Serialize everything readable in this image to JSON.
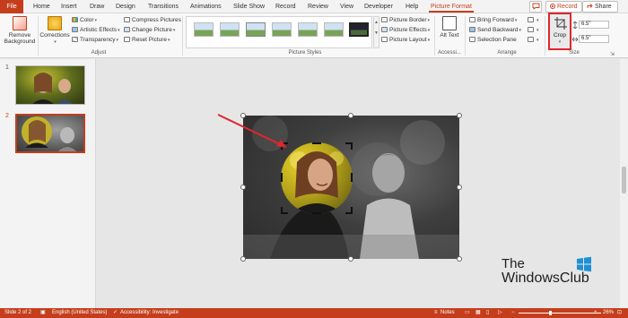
{
  "tabs": [
    "File",
    "Home",
    "Insert",
    "Draw",
    "Design",
    "Transitions",
    "Animations",
    "Slide Show",
    "Record",
    "Review",
    "View",
    "Developer",
    "Help",
    "Picture Format"
  ],
  "active_tab": "Picture Format",
  "topbar": {
    "record_label": "Record",
    "share_label": "Share"
  },
  "ribbon": {
    "adjust": {
      "remove_background": "Remove Background",
      "corrections": "Corrections",
      "color": "Color",
      "artistic_effects": "Artistic Effects",
      "transparency": "Transparency",
      "compress_pictures": "Compress Pictures",
      "change_picture": "Change Picture",
      "reset_picture": "Reset Picture",
      "label": "Adjust"
    },
    "picture_styles": {
      "picture_border": "Picture Border",
      "picture_effects": "Picture Effects",
      "picture_layout": "Picture Layout",
      "label": "Picture Styles"
    },
    "accessibility": {
      "alt_text": "Alt Text",
      "label": "Accessi..."
    },
    "arrange": {
      "bring_forward": "Bring Forward",
      "send_backward": "Send Backward",
      "selection_pane": "Selection Pane",
      "label": "Arrange"
    },
    "size": {
      "crop": "Crop",
      "height": "6.5\"",
      "width": "6.5\"",
      "label": "Size"
    }
  },
  "slides": [
    {
      "number": "1"
    },
    {
      "number": "2"
    }
  ],
  "watermark": {
    "line1": "The",
    "line2": "WindowsClub"
  },
  "status": {
    "slide": "Slide 2 of 2",
    "language": "English (United States)",
    "accessibility": "Accessibility: Investigate",
    "notes": "Notes",
    "zoom": "26%"
  },
  "colors": {
    "accent": "#c43e1c",
    "crop_highlight": "#e0262e"
  }
}
